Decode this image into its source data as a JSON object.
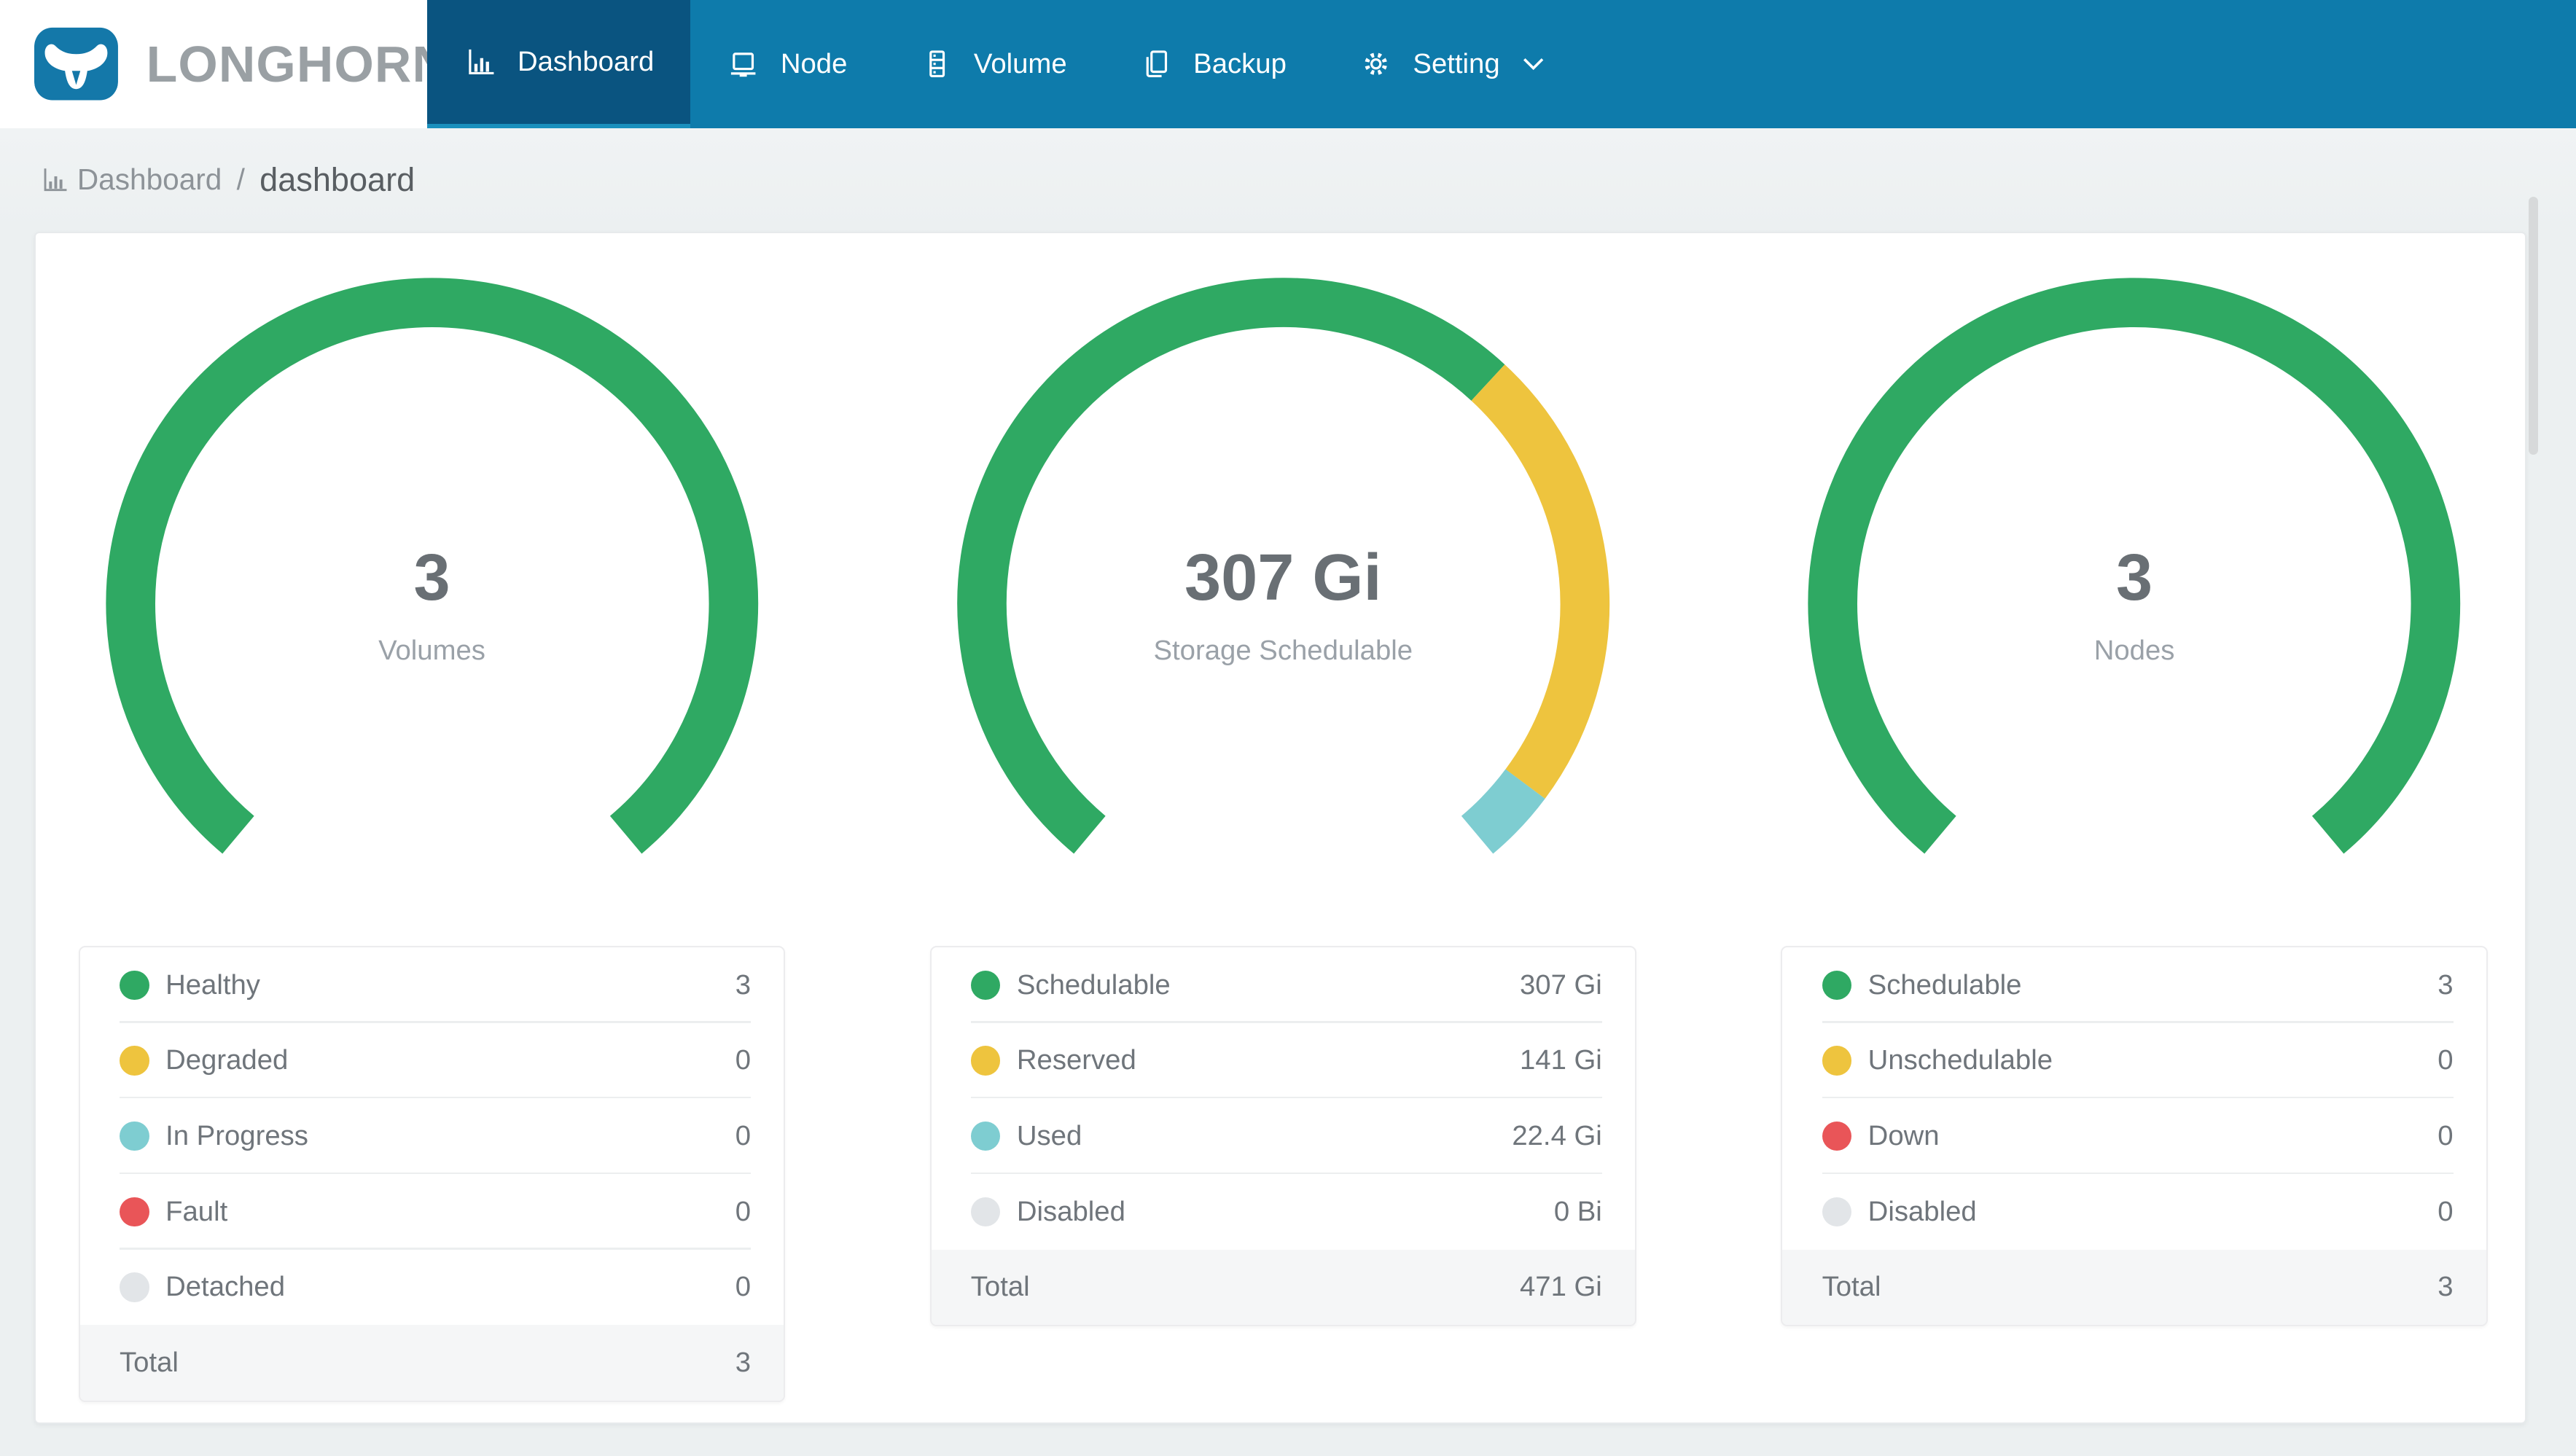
{
  "brand": {
    "name": "LONGHORN"
  },
  "nav": {
    "items": [
      {
        "label": "Dashboard",
        "icon": "bar-chart-icon",
        "active": true
      },
      {
        "label": "Node",
        "icon": "laptop-icon",
        "active": false
      },
      {
        "label": "Volume",
        "icon": "volume-stack-icon",
        "active": false
      },
      {
        "label": "Backup",
        "icon": "backup-copy-icon",
        "active": false
      },
      {
        "label": "Setting",
        "icon": "gear-icon",
        "active": false,
        "has_dropdown": true
      }
    ]
  },
  "breadcrumb": {
    "section": "Dashboard",
    "separator": "/",
    "page": "dashboard"
  },
  "colors": {
    "nav_blue": "#0e7bab",
    "active_tab_blue": "#0a5480",
    "active_tab_underline": "#1b90bd",
    "healthy_green": "#2fa963",
    "warning_yellow": "#eec43e",
    "progress_teal": "#7ecdd1",
    "fault_red": "#e95558",
    "disabled_gray": "#e2e5e8",
    "page_background": "#ecf0f1"
  },
  "chart_data": [
    {
      "type": "gauge-donut",
      "title": "Volumes",
      "center_value": "3",
      "center_label": "Volumes",
      "arc_span_deg": 280,
      "ring_thickness": 30,
      "segments": [
        {
          "label": "Healthy",
          "value": 3,
          "display": "3",
          "color": "#2fa963"
        },
        {
          "label": "Degraded",
          "value": 0,
          "display": "0",
          "color": "#eec43e"
        },
        {
          "label": "In Progress",
          "value": 0,
          "display": "0",
          "color": "#7ecdd1"
        },
        {
          "label": "Fault",
          "value": 0,
          "display": "0",
          "color": "#e95558"
        },
        {
          "label": "Detached",
          "value": 0,
          "display": "0",
          "color": "#e2e5e8"
        }
      ],
      "total_label": "Total",
      "total_value": "3"
    },
    {
      "type": "gauge-donut",
      "title": "Storage Schedulable",
      "center_value": "307 Gi",
      "center_label": "Storage Schedulable",
      "arc_span_deg": 280,
      "ring_thickness": 30,
      "segments": [
        {
          "label": "Schedulable",
          "value": 307,
          "display": "307 Gi",
          "color": "#2fa963"
        },
        {
          "label": "Reserved",
          "value": 141,
          "display": "141 Gi",
          "color": "#eec43e"
        },
        {
          "label": "Used",
          "value": 22.4,
          "display": "22.4 Gi",
          "color": "#7ecdd1"
        },
        {
          "label": "Disabled",
          "value": 0,
          "display": "0 Bi",
          "color": "#e2e5e8"
        }
      ],
      "total_label": "Total",
      "total_value": "471 Gi"
    },
    {
      "type": "gauge-donut",
      "title": "Nodes",
      "center_value": "3",
      "center_label": "Nodes",
      "arc_span_deg": 280,
      "ring_thickness": 30,
      "segments": [
        {
          "label": "Schedulable",
          "value": 3,
          "display": "3",
          "color": "#2fa963"
        },
        {
          "label": "Unschedulable",
          "value": 0,
          "display": "0",
          "color": "#eec43e"
        },
        {
          "label": "Down",
          "value": 0,
          "display": "0",
          "color": "#e95558"
        },
        {
          "label": "Disabled",
          "value": 0,
          "display": "0",
          "color": "#e2e5e8"
        }
      ],
      "total_label": "Total",
      "total_value": "3"
    }
  ]
}
